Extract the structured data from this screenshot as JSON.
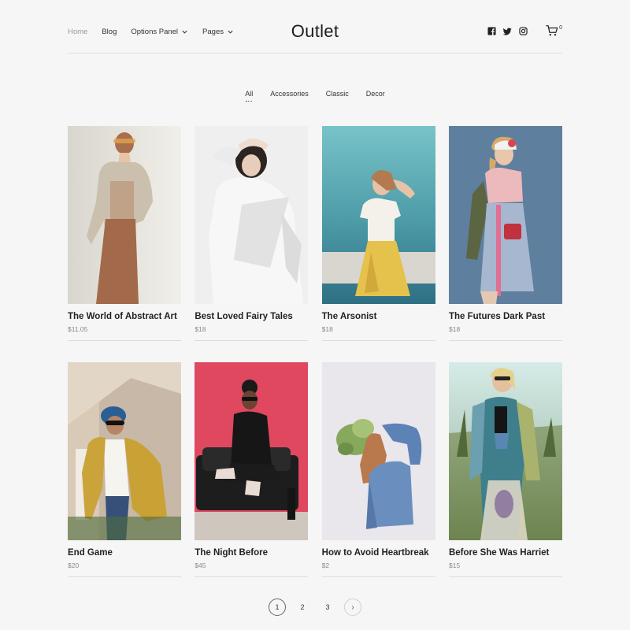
{
  "header": {
    "logo": "Outlet",
    "nav": [
      {
        "label": "Home",
        "active": true,
        "dropdown": false
      },
      {
        "label": "Blog",
        "active": false,
        "dropdown": false
      },
      {
        "label": "Options Panel",
        "active": false,
        "dropdown": true
      },
      {
        "label": "Pages",
        "active": false,
        "dropdown": true
      }
    ],
    "social_icons": [
      "facebook-icon",
      "twitter-icon",
      "instagram-icon"
    ],
    "cart": {
      "icon": "cart-icon",
      "count": "0"
    }
  },
  "filters": {
    "items": [
      "All",
      "Accessories",
      "Classic",
      "Decor"
    ],
    "active": "All"
  },
  "products": [
    {
      "title": "The World of Abstract Art",
      "price": "$11.05"
    },
    {
      "title": "Best Loved Fairy Tales",
      "price": "$18"
    },
    {
      "title": "The Arsonist",
      "price": "$18"
    },
    {
      "title": "The Futures Dark Past",
      "price": "$18"
    },
    {
      "title": "End Game",
      "price": "$20"
    },
    {
      "title": "The Night Before",
      "price": "$45"
    },
    {
      "title": "How to Avoid Heartbreak",
      "price": "$2"
    },
    {
      "title": "Before She Was Harriet",
      "price": "$15"
    }
  ],
  "pagination": {
    "pages": [
      "1",
      "2",
      "3"
    ],
    "current": "1",
    "next": "›"
  },
  "colors": {
    "background": "#f6f6f6",
    "text": "#222222",
    "muted": "#8a8a8a"
  }
}
